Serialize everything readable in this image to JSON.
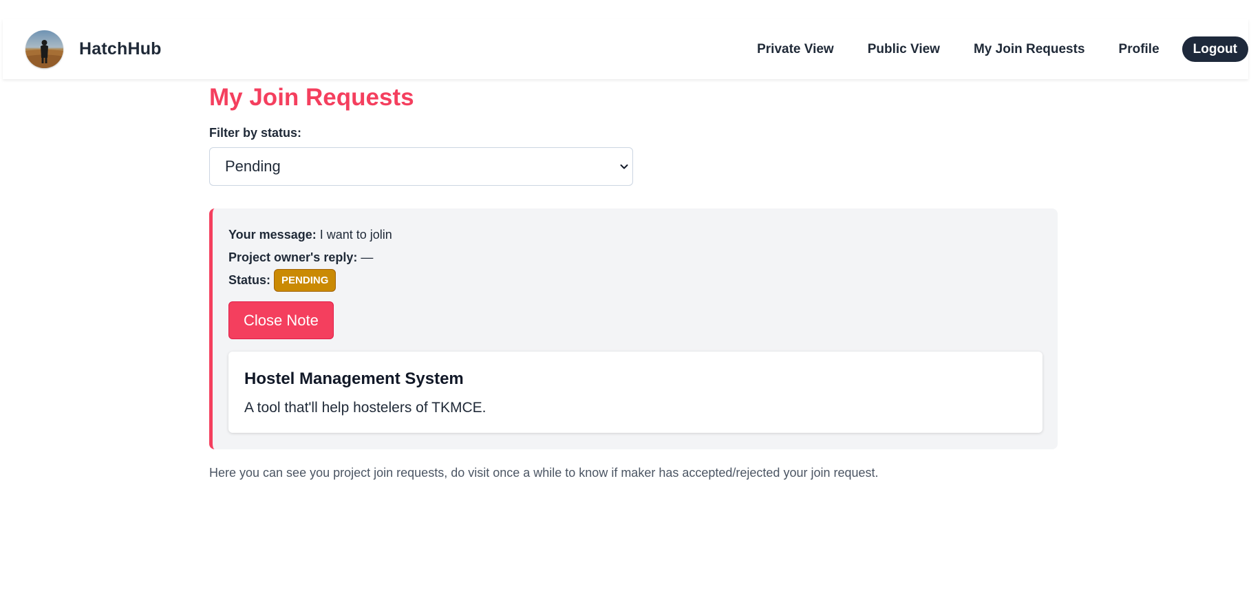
{
  "header": {
    "brand": "HatchHub",
    "nav": [
      {
        "label": "Private View"
      },
      {
        "label": "Public View"
      },
      {
        "label": "My Join Requests"
      },
      {
        "label": "Profile"
      }
    ],
    "logout_label": "Logout"
  },
  "main": {
    "title": "My Join Requests",
    "filter": {
      "label": "Filter by status:",
      "selected": "Pending"
    },
    "request": {
      "message_label": "Your message:",
      "message": "I want to jolin",
      "reply_label": "Project owner's reply:",
      "reply": "—",
      "status_label": "Status:",
      "status": "PENDING",
      "close_label": "Close Note",
      "project": {
        "title": "Hostel Management System",
        "description": "A tool that'll help hostelers of TKMCE."
      }
    },
    "footnote": "Here you can see you project join requests, do visit once a while to know if maker has accepted/rejected your join request."
  },
  "colors": {
    "accent": "#f43f5e",
    "pending_badge": "#ca8a04",
    "logout_bg": "#1e293b",
    "card_bg": "#f3f4f6"
  },
  "icons": {
    "select_indicator": "chevron-down-icon"
  }
}
